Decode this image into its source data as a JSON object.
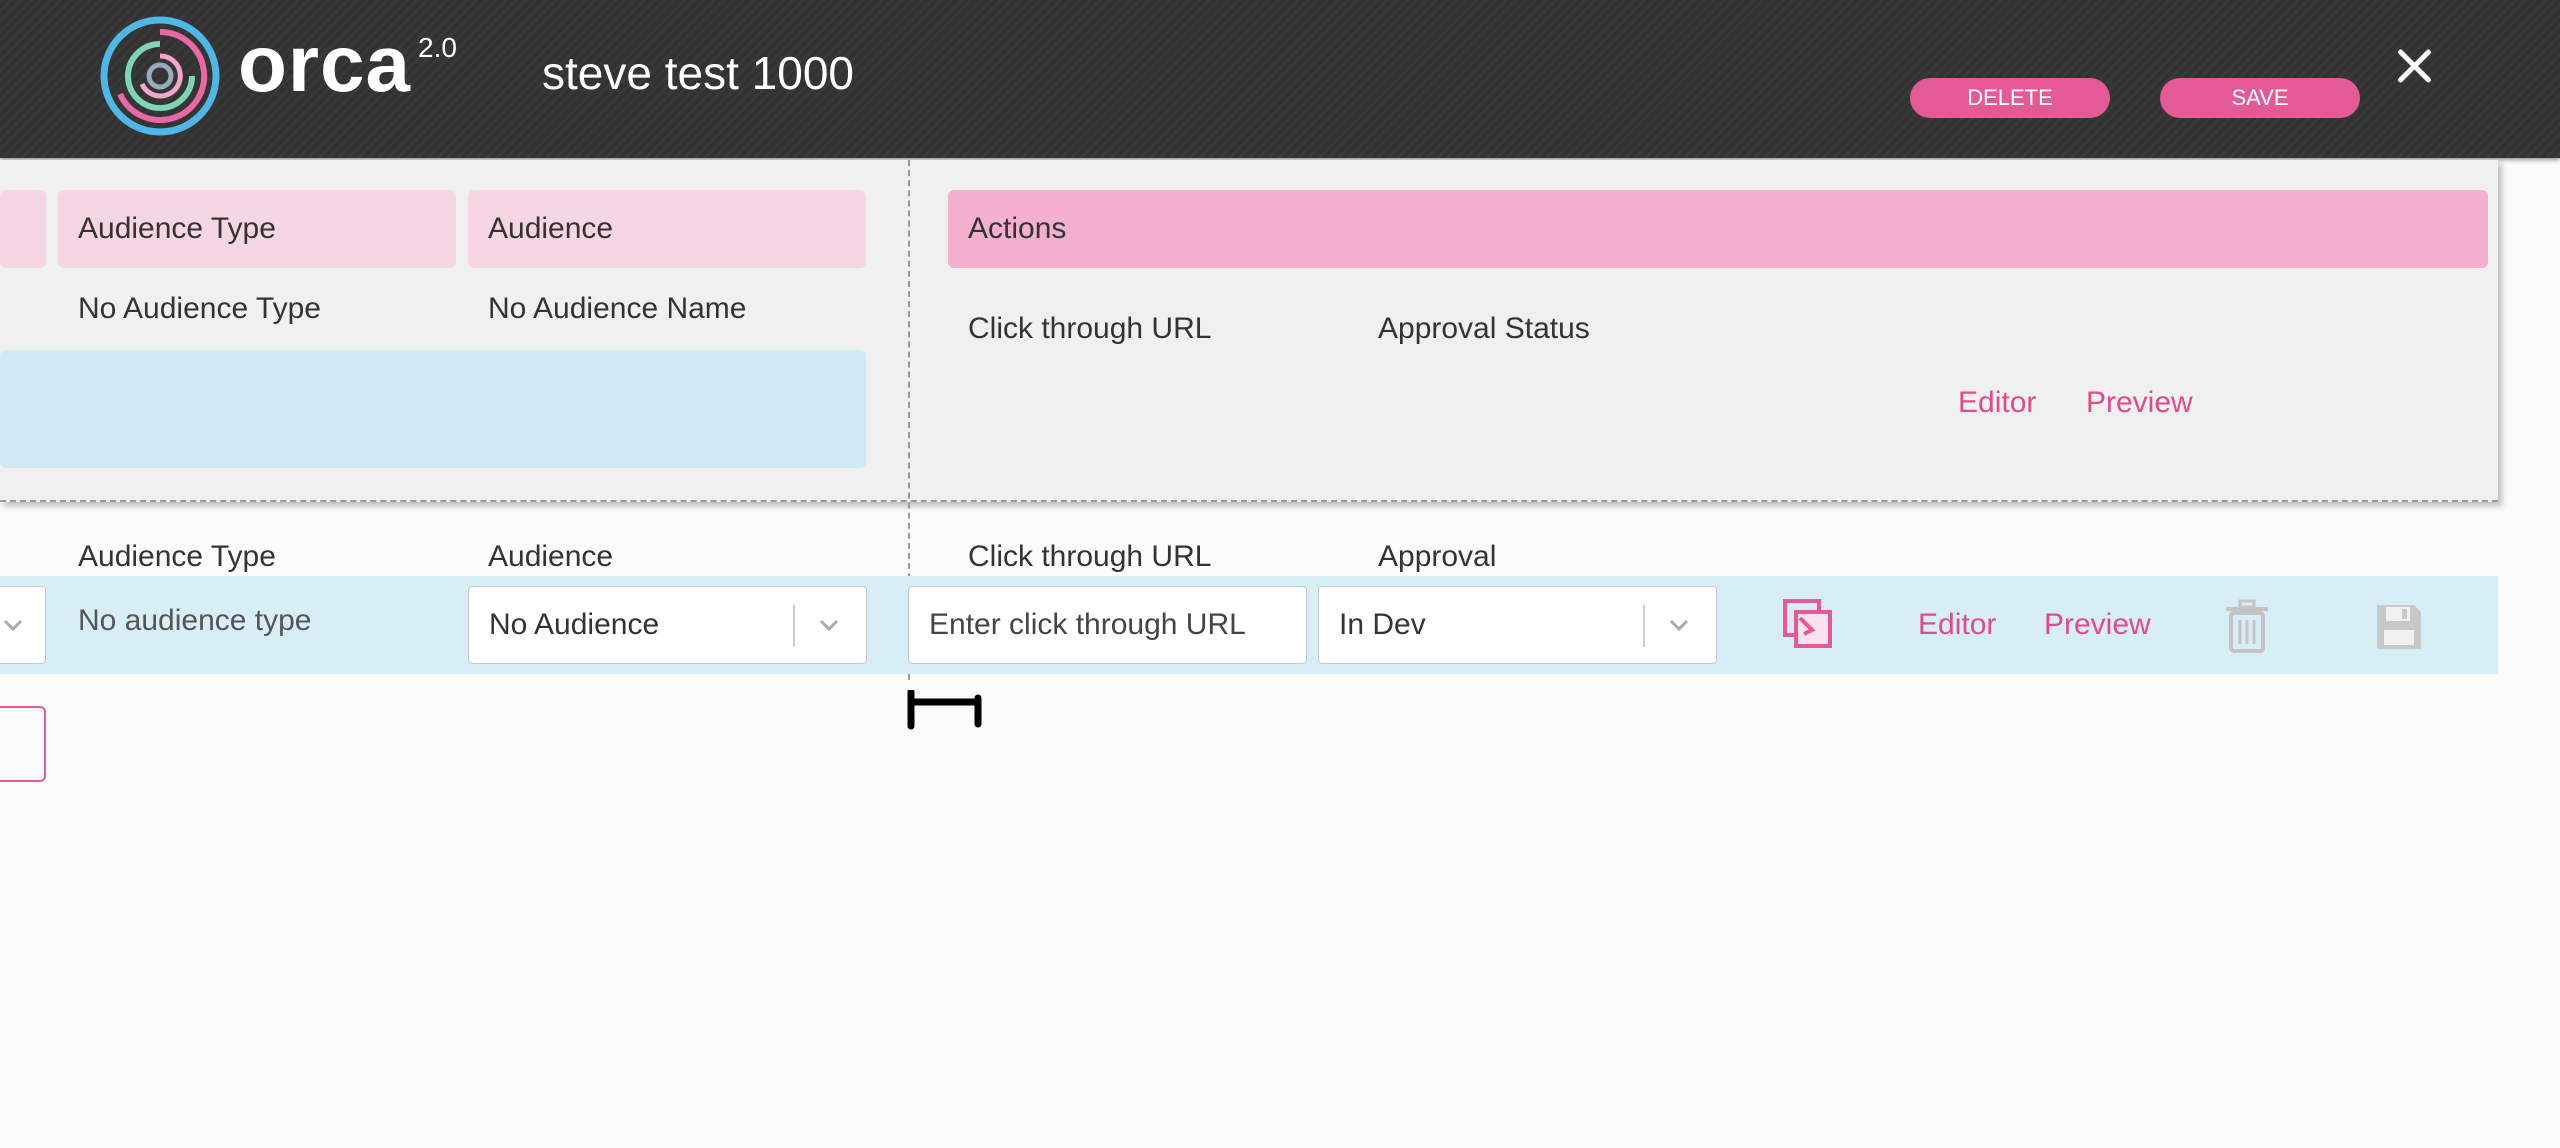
{
  "header": {
    "logo_text": "orca",
    "logo_version": "2.0",
    "project_title": "steve test 1000",
    "delete_label": "DELETE",
    "save_label": "SAVE",
    "close_icon": "close-icon"
  },
  "top_panel": {
    "audience_type_header": "Audience Type",
    "audience_header": "Audience",
    "actions_header": "Actions",
    "audience_type_value": "No Audience Type",
    "audience_value": "No Audience Name",
    "click_through_label": "Click through URL",
    "approval_status_label": "Approval Status",
    "editor_link": "Editor",
    "preview_link": "Preview"
  },
  "row": {
    "labels": {
      "audience_type": "Audience Type",
      "audience": "Audience",
      "click_through": "Click through URL",
      "approval": "Approval"
    },
    "audience_type_value": "No audience type",
    "audience_select_value": "No Audience",
    "url_placeholder": "Enter click through URL",
    "approval_select_value": "In Dev",
    "editor_link": "Editor",
    "preview_link": "Preview",
    "icons": [
      "copy-icon",
      "trash-icon",
      "floppy-save-icon"
    ]
  },
  "colors": {
    "brand_pink": "#e35a97",
    "header_bg": "#333333",
    "row_blue": "#d8eef7",
    "actions_pink": "#f5afcf"
  }
}
